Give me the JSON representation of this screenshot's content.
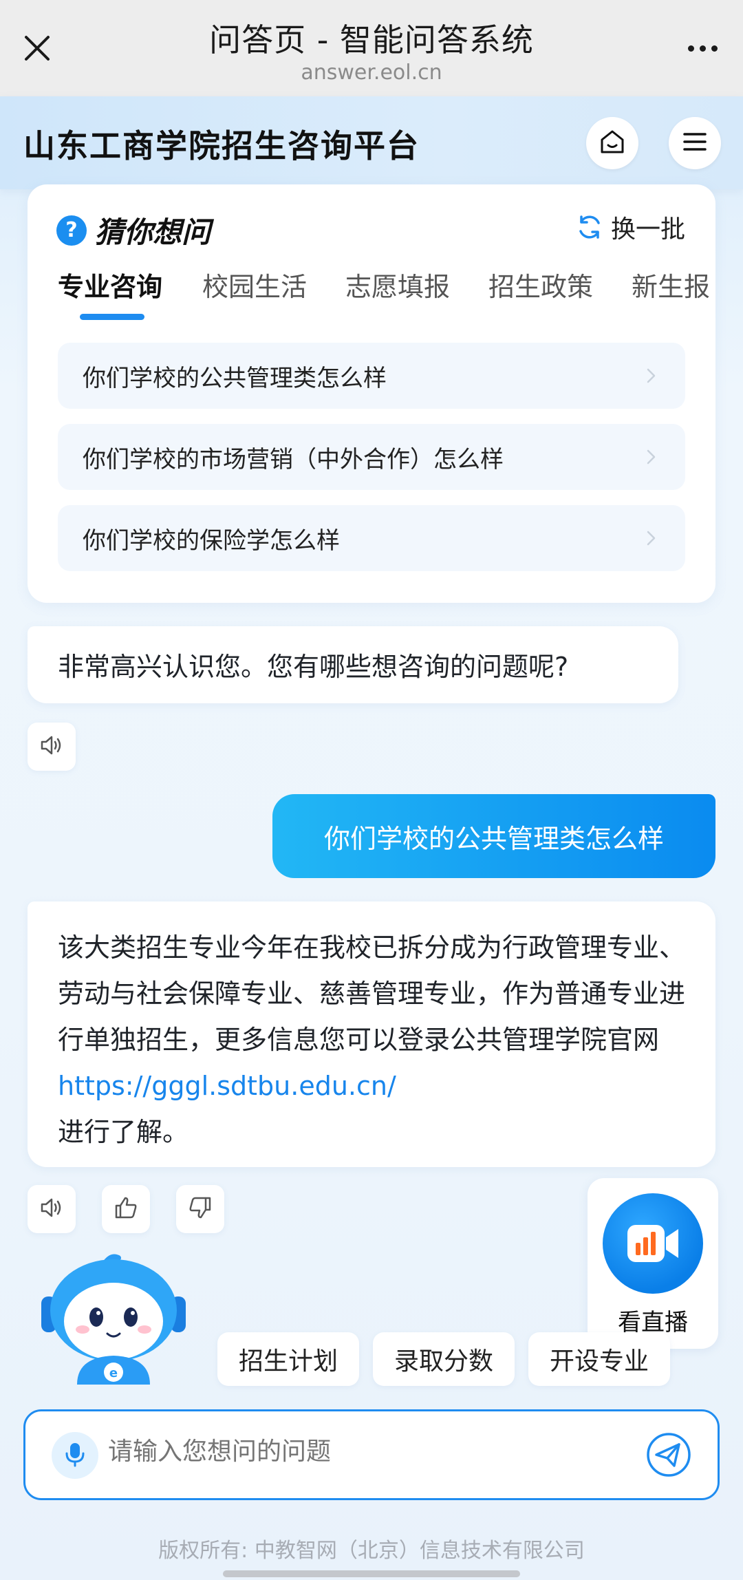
{
  "browser": {
    "title": "问答页 - 智能问答系统",
    "url": "answer.eol.cn"
  },
  "header": {
    "title": "山东工商学院招生咨询平台"
  },
  "guess": {
    "title": "猜你想问",
    "refresh_label": "换一批",
    "tabs": [
      "专业咨询",
      "校园生活",
      "志愿填报",
      "招生政策",
      "新生报"
    ],
    "active_tab": "专业咨询",
    "questions": [
      "你们学校的公共管理类怎么样",
      "你们学校的市场营销（中外合作）怎么样",
      "你们学校的保险学怎么样"
    ]
  },
  "chat": {
    "greeting": "非常高兴认识您。您有哪些想咨询的问题呢?",
    "user_message": "你们学校的公共管理类怎么样",
    "answer_text": "该大类招生专业今年在我校已拆分成为行政管理专业、劳动与社会保障专业、慈善管理专业，作为普通专业进行单独招生，更多信息您可以登录公共管理学院官网",
    "answer_link": "https://gggl.sdtbu.edu.cn/",
    "answer_tail": "进行了解。"
  },
  "live": {
    "label": "看直播"
  },
  "quick_chips": [
    "招生计划",
    "录取分数",
    "开设专业"
  ],
  "input": {
    "placeholder": "请输入您想问的问题"
  },
  "footer": {
    "text": "版权所有: 中教智网（北京）信息技术有限公司"
  },
  "colors": {
    "accent": "#1E8CF0",
    "link": "#1785EC",
    "user_bubble_start": "#22B7F5",
    "user_bubble_end": "#0A8BF0",
    "live_icon_bars": "#FF6A1F"
  },
  "icons": {
    "close": "close-icon",
    "more": "more-icon",
    "home": "home-icon",
    "menu": "menu-icon",
    "question": "question-icon",
    "refresh": "refresh-icon",
    "chevron": "chevron-right-icon",
    "speaker": "speaker-icon",
    "thumbs_up": "thumbs-up-icon",
    "thumbs_down": "thumbs-down-icon",
    "live": "live-video-icon",
    "mic": "microphone-icon",
    "send": "send-icon"
  }
}
